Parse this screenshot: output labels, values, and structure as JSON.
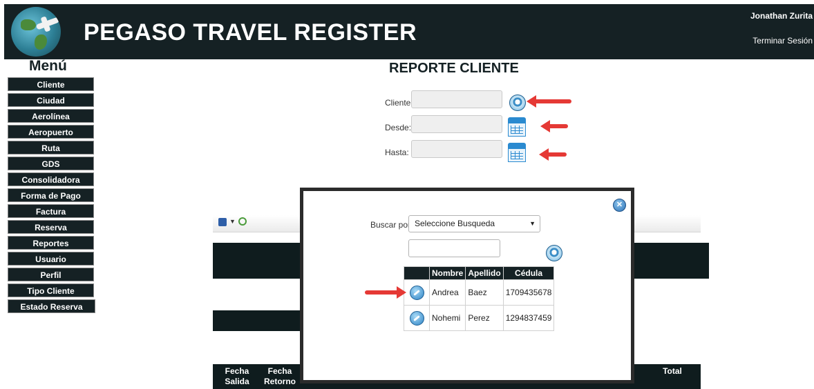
{
  "header": {
    "app_title": "PEGASO TRAVEL REGISTER",
    "user_name": "Jonathan Zurita",
    "logout_label": "Terminar Sesión"
  },
  "menu": {
    "title": "Menú",
    "items": [
      {
        "label": "Cliente"
      },
      {
        "label": "Ciudad"
      },
      {
        "label": "Aerolínea"
      },
      {
        "label": "Aeropuerto"
      },
      {
        "label": "Ruta"
      },
      {
        "label": "GDS"
      },
      {
        "label": "Consolidadora"
      },
      {
        "label": "Forma de Pago"
      },
      {
        "label": "Factura"
      },
      {
        "label": "Reserva"
      },
      {
        "label": "Reportes"
      },
      {
        "label": "Usuario"
      },
      {
        "label": "Perfil"
      },
      {
        "label": "Tipo Cliente"
      },
      {
        "label": "Estado Reserva"
      }
    ]
  },
  "report": {
    "title": "REPORTE CLIENTE",
    "fields": {
      "cliente_label": "Cliente:",
      "desde_label": "Desde:",
      "hasta_label": "Hasta:"
    },
    "table_headers": {
      "fecha_salida": "Fecha Salida",
      "fecha_retorno": "Fecha Retorno",
      "total": "Total"
    }
  },
  "modal": {
    "search_label": "Buscar por:",
    "select_value": "Seleccione Busqueda",
    "columns": [
      "Nombre",
      "Apellido",
      "Cédula"
    ],
    "rows": [
      {
        "nombre": "Andrea",
        "apellido": "Baez",
        "cedula": "1709435678"
      },
      {
        "nombre": "Nohemi",
        "apellido": "Perez",
        "cedula": "1294837459"
      }
    ]
  },
  "colors": {
    "header_bg": "#152124",
    "accent_arrow": "#e53935",
    "icon_blue": "#2a8ad0"
  }
}
